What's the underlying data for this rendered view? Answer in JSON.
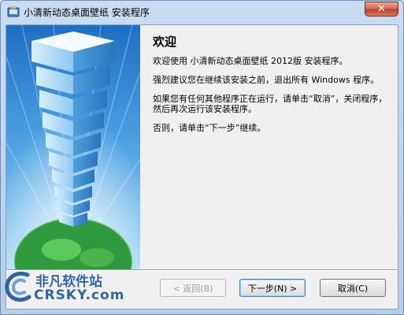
{
  "window": {
    "title": "小清新动态桌面壁纸 安装程序",
    "close_glyph": "✕"
  },
  "welcome": {
    "heading": "欢迎",
    "line1": "欢迎使用 小清新动态桌面壁纸 2012版 安装程序。",
    "line2": "强烈建议您在继续该安装之前，退出所有 Windows 程序。",
    "line3": "如果您有任何其他程序正在运行，请单击“取消”，关闭程序，然后再次运行该安装程序。",
    "line4": "否则，请单击“下一步”继续。"
  },
  "buttons": {
    "back": "< 返回(B)",
    "next": "下一步(N) >",
    "cancel": "取消(C)"
  },
  "watermark": {
    "cn": "非凡软件站",
    "en": "CRSKY.com"
  },
  "colors": {
    "accent": "#2d63a8",
    "close_red": "#c0402a"
  }
}
